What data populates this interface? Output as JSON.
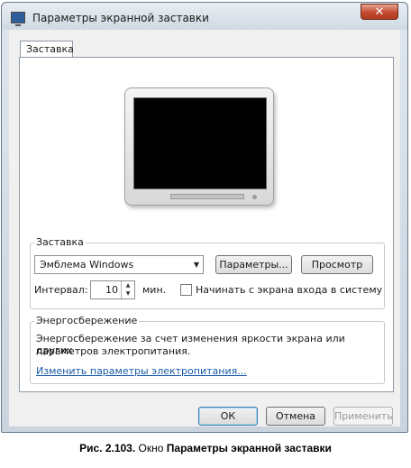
{
  "window": {
    "title": "Параметры экранной заставки",
    "close_label": "✕"
  },
  "tabs": [
    {
      "label": "Заставка",
      "active": true
    }
  ],
  "screensaver": {
    "group_label": "Заставка",
    "selected": "Эмблема Windows",
    "settings_button": "Параметры...",
    "preview_button": "Просмотр",
    "interval_label": "Интервал:",
    "interval_value": "10",
    "interval_unit": "мин.",
    "resume_logon_label": "Начинать с экрана входа в систему",
    "resume_logon_checked": false
  },
  "power": {
    "group_label": "Энергосбережение",
    "description_line1": "Энергосбережение за счет изменения яркости экрана или других",
    "description_line2": "параметров электропитания.",
    "link": "Изменить параметры электропитания..."
  },
  "buttons": {
    "ok": "ОК",
    "cancel": "Отмена",
    "apply": "Применить"
  },
  "caption": {
    "number": "Рис. 2.103.",
    "word": "Окно",
    "title": "Параметры экранной заставки"
  }
}
